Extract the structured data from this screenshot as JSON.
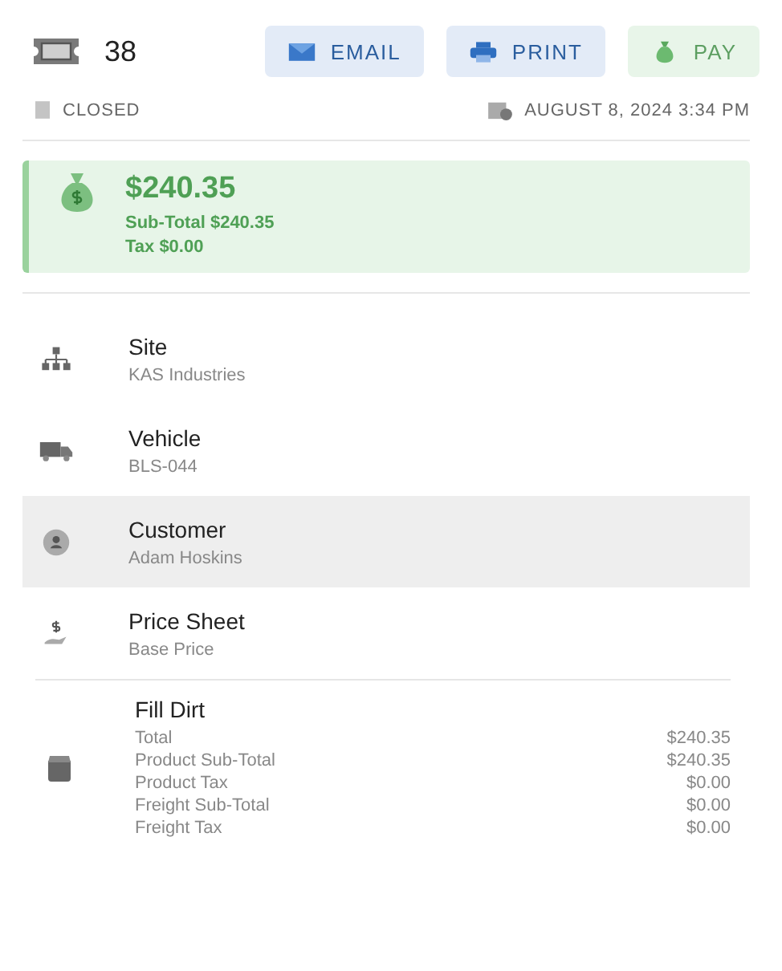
{
  "ticket": {
    "number": "38",
    "status": "CLOSED",
    "date": "AUGUST 8, 2024 3:34 PM"
  },
  "buttons": [
    {
      "label": "EMAIL",
      "kind": "email"
    },
    {
      "label": "PRINT",
      "kind": "print"
    },
    {
      "label": "PAY",
      "kind": "pay"
    }
  ],
  "summary": {
    "total": "$240.35",
    "subtotal": "Sub-Total $240.35",
    "tax": "Tax $0.00"
  },
  "details": [
    {
      "kind": "site",
      "label": "Site",
      "value": "KAS Industries",
      "selected": false
    },
    {
      "kind": "vehicle",
      "label": "Vehicle",
      "value": "BLS-044",
      "selected": false
    },
    {
      "kind": "customer",
      "label": "Customer",
      "value": "Adam Hoskins",
      "selected": true
    },
    {
      "kind": "price",
      "label": "Price Sheet",
      "value": "Base Price",
      "selected": false
    }
  ],
  "product": {
    "name": "Fill Dirt",
    "lines": [
      {
        "label": "Total",
        "amount": "$240.35"
      },
      {
        "label": "Product Sub-Total",
        "amount": "$240.35"
      },
      {
        "label": "Product Tax",
        "amount": "$0.00"
      },
      {
        "label": "Freight Sub-Total",
        "amount": "$0.00"
      },
      {
        "label": "Freight Tax",
        "amount": "$0.00"
      }
    ]
  }
}
